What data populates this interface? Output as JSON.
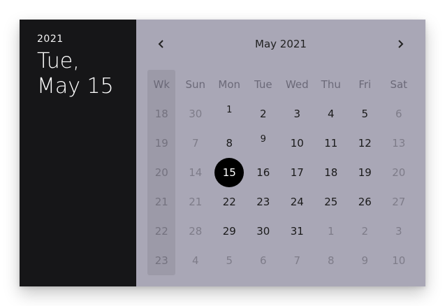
{
  "side": {
    "year": "2021",
    "date_line1": "Tue,",
    "date_line2": "May 15"
  },
  "header": {
    "month": "May 2021",
    "prev_icon": "chevron-left-icon",
    "next_icon": "chevron-right-icon"
  },
  "weekdays": [
    "Wk",
    "Sun",
    "Mon",
    "Tue",
    "Wed",
    "Thu",
    "Fri",
    "Sat"
  ],
  "weeks": [
    {
      "wk": "18",
      "days": [
        "30",
        "1",
        "2",
        "3",
        "4",
        "5",
        "6"
      ]
    },
    {
      "wk": "19",
      "days": [
        "7",
        "8",
        "9",
        "10",
        "11",
        "12",
        "13"
      ]
    },
    {
      "wk": "20",
      "days": [
        "14",
        "15",
        "16",
        "17",
        "18",
        "19",
        "20"
      ]
    },
    {
      "wk": "21",
      "days": [
        "21",
        "22",
        "23",
        "24",
        "25",
        "26",
        "27"
      ]
    },
    {
      "wk": "22",
      "days": [
        "28",
        "29",
        "30",
        "31",
        "1",
        "2",
        "3"
      ]
    },
    {
      "wk": "23",
      "days": [
        "4",
        "5",
        "6",
        "7",
        "8",
        "9",
        "10"
      ]
    }
  ],
  "selected_day": "15",
  "colors": {
    "sidebar": "#161618",
    "panel": "#a9a7b6",
    "week_column": "#9c9aa8",
    "selected": "#000000"
  }
}
